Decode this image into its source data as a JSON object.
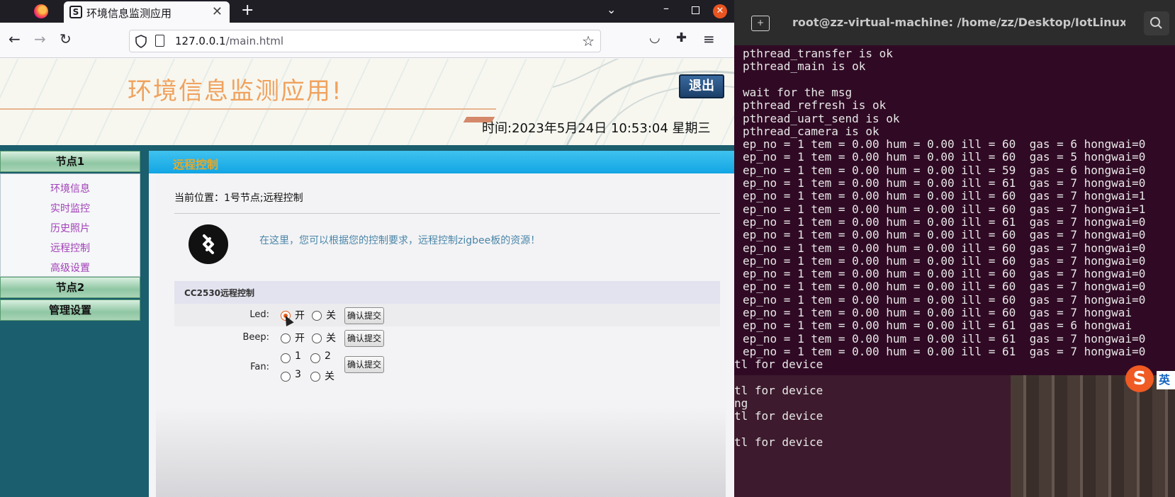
{
  "browser": {
    "tab_title": "环境信息监测应用",
    "url_host": "127.0.0.1",
    "url_path": "/main.html"
  },
  "page": {
    "app_title": "环境信息监测应用!",
    "logout_label": "退出",
    "time_text": "时间:2023年5月24日 10:53:04 星期三",
    "node1_label": "节点1",
    "node1_items": [
      "环境信息",
      "实时监控",
      "历史照片",
      "远程控制",
      "高级设置"
    ],
    "node2_label": "节点2",
    "admin_label": "管理设置",
    "section_title": "远程控制",
    "breadcrumb": "当前位置：1号节点;远程控制",
    "hint": "在这里，您可以根据您的控制要求，远程控制zigbee板的资源！",
    "control_header": "CC2530远程控制",
    "led": {
      "label": "Led:",
      "on": "开",
      "off": "关",
      "selected": "on"
    },
    "beep": {
      "label": "Beep:",
      "on": "开",
      "off": "关"
    },
    "fan": {
      "label": "Fan:",
      "opt1": "1",
      "opt2": "2",
      "opt3": "3",
      "off": "关"
    },
    "submit_label": "确认提交"
  },
  "terminal": {
    "title": "root@zz-virtual-machine: /home/zz/Desktop/IotLinux/code...",
    "lines": [
      "pthread_transfer is ok",
      "pthread_main is ok",
      "",
      "wait for the msg",
      "pthread_refresh is ok",
      "pthread_uart_send is ok",
      "pthread_camera is ok",
      "ep_no = 1 tem = 0.00 hum = 0.00 ill = 60  gas = 6 hongwai=0",
      "ep_no = 1 tem = 0.00 hum = 0.00 ill = 60  gas = 5 hongwai=0",
      "ep_no = 1 tem = 0.00 hum = 0.00 ill = 59  gas = 6 hongwai=0",
      "ep_no = 1 tem = 0.00 hum = 0.00 ill = 61  gas = 7 hongwai=0",
      "ep_no = 1 tem = 0.00 hum = 0.00 ill = 60  gas = 7 hongwai=1",
      "ep_no = 1 tem = 0.00 hum = 0.00 ill = 60  gas = 7 hongwai=1",
      "ep_no = 1 tem = 0.00 hum = 0.00 ill = 61  gas = 7 hongwai=0",
      "ep_no = 1 tem = 0.00 hum = 0.00 ill = 60  gas = 7 hongwai=0",
      "ep_no = 1 tem = 0.00 hum = 0.00 ill = 60  gas = 7 hongwai=0",
      "ep_no = 1 tem = 0.00 hum = 0.00 ill = 60  gas = 7 hongwai=0",
      "ep_no = 1 tem = 0.00 hum = 0.00 ill = 60  gas = 7 hongwai=0",
      "ep_no = 1 tem = 0.00 hum = 0.00 ill = 60  gas = 7 hongwai=0",
      "ep_no = 1 tem = 0.00 hum = 0.00 ill = 60  gas = 7 hongwai=0",
      "ep_no = 1 tem = 0.00 hum = 0.00 ill = 60  gas = 7 hongwai",
      "ep_no = 1 tem = 0.00 hum = 0.00 ill = 61  gas = 6 hongwai",
      "ep_no = 1 tem = 0.00 hum = 0.00 ill = 61  gas = 7 hongwai=0",
      "ep_no = 1 tem = 0.00 hum = 0.00 ill = 61  gas = 7 hongwai=0"
    ],
    "lower_lines": [
      "tl for device",
      "",
      "tl for device",
      "ng",
      "tl for device",
      "",
      "tl for device"
    ],
    "ime_label": "英",
    "ime_icon": "S"
  }
}
